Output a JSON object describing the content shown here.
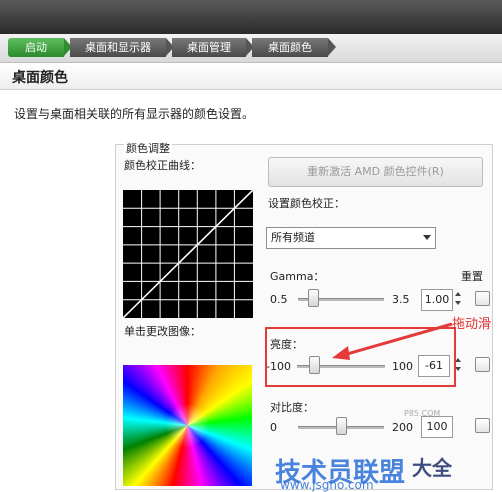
{
  "breadcrumbs": [
    "启动",
    "桌面和显示器",
    "桌面管理",
    "桌面颜色"
  ],
  "header": {
    "title": "桌面颜色"
  },
  "description": "设置与桌面相关联的所有显示器的颜色设置。",
  "panel": {
    "group_title": "颜色调整",
    "curve_label": "颜色校正曲线：",
    "image_label": "单击更改图像：",
    "reactivate_button": "重新激活 AMD 颜色控件(R)",
    "set_correction_label": "设置颜色校正：",
    "channel_select": "所有频道",
    "reset_label": "重置",
    "gamma": {
      "label": "Gamma：",
      "min": "0.5",
      "max": "3.5",
      "value": "1.00",
      "level": 0.17
    },
    "brightness": {
      "label": "亮度：",
      "min": "-100",
      "max": "100",
      "value": "-61",
      "level": 0.195
    },
    "contrast": {
      "label": "对比度：",
      "min": "0",
      "max": "200",
      "value": "100",
      "level": 0.5
    }
  },
  "annotation": {
    "note": "拖动滑",
    "color": "#e53a3a"
  },
  "watermark": {
    "main": "技术员联盟",
    "right": "大全",
    "url": "www.jsgho.com",
    "small": "P85.COM"
  }
}
